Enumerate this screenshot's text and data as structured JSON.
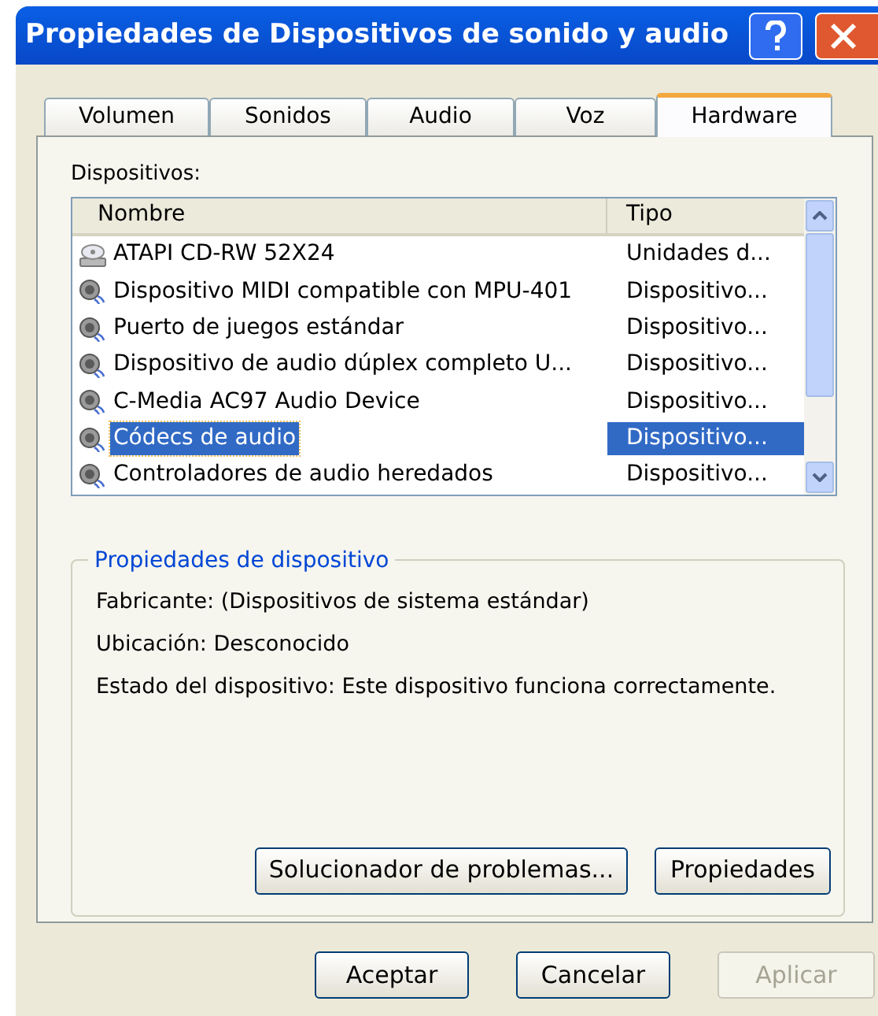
{
  "window": {
    "title": "Propiedades de Dispositivos de sonido y audio"
  },
  "tabs": [
    {
      "label": "Volumen",
      "selected": false
    },
    {
      "label": "Sonidos",
      "selected": false
    },
    {
      "label": "Audio",
      "selected": false
    },
    {
      "label": "Voz",
      "selected": false
    },
    {
      "label": "Hardware",
      "selected": true
    }
  ],
  "devices": {
    "label": "Dispositivos:",
    "columns": [
      "Nombre",
      "Tipo"
    ],
    "rows": [
      {
        "kind": "cdrom",
        "name": "ATAPI CD-RW 52X24",
        "type": "Unidades d...",
        "selected": false
      },
      {
        "kind": "speaker",
        "name": "Dispositivo MIDI compatible con MPU-401",
        "type": "Dispositivo...",
        "selected": false
      },
      {
        "kind": "speaker",
        "name": "Puerto de juegos estándar",
        "type": "Dispositivo...",
        "selected": false
      },
      {
        "kind": "speaker",
        "name": "Dispositivo de audio dúplex completo U...",
        "type": "Dispositivo...",
        "selected": false
      },
      {
        "kind": "speaker",
        "name": "C-Media AC97 Audio Device",
        "type": "Dispositivo...",
        "selected": false
      },
      {
        "kind": "speaker",
        "name": "Códecs de audio",
        "type": "Dispositivo...",
        "selected": true
      },
      {
        "kind": "speaker",
        "name": "Controladores de audio heredados",
        "type": "Dispositivo...",
        "selected": false
      }
    ]
  },
  "properties": {
    "title": "Propiedades de dispositivo",
    "lines": [
      "Fabricante: (Dispositivos de sistema estándar)",
      "Ubicación: Desconocido",
      "Estado del dispositivo: Este dispositivo funciona correctamente."
    ],
    "buttons": [
      {
        "label": "Solucionador de problemas...",
        "disabled": false
      },
      {
        "label": "Propiedades",
        "disabled": false
      }
    ]
  },
  "buttons": [
    {
      "label": "Aceptar",
      "disabled": false
    },
    {
      "label": "Cancelar",
      "disabled": false
    },
    {
      "label": "Aplicar",
      "disabled": true
    }
  ]
}
